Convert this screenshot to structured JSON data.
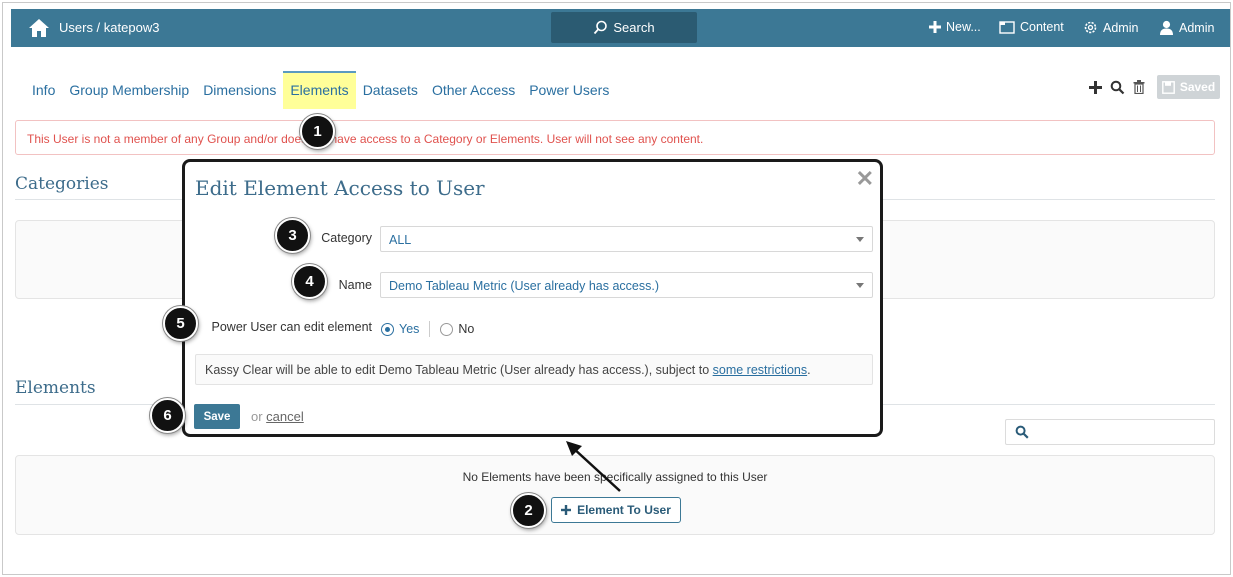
{
  "topbar": {
    "breadcrumb": "Users / katepow3",
    "search_label": "Search",
    "new_label": "New...",
    "content_label": "Content",
    "admin_label": "Admin",
    "user_label": "Admin"
  },
  "tabs": [
    "Info",
    "Group Membership",
    "Dimensions",
    "Elements",
    "Datasets",
    "Other Access",
    "Power Users"
  ],
  "active_tab": "Elements",
  "toolbar": {
    "saved_label": "Saved"
  },
  "alert": {
    "text": "This User is not a member of any Group and/or does not have access to a Category or Elements. User will not see any content."
  },
  "sections": {
    "categories_title": "Categories",
    "elements_title": "Elements"
  },
  "elements_panel": {
    "empty_message": "No Elements have been specifically assigned to this User",
    "add_button": "Element To User"
  },
  "modal": {
    "title": "Edit Element Access to User",
    "category_label": "Category",
    "category_value": "ALL",
    "name_label": "Name",
    "name_value": "Demo  Tableau Metric (User already has access.)",
    "power_user_label": "Power User can edit element",
    "radio_yes": "Yes",
    "radio_no": "No",
    "selected": "Yes",
    "info_text": "Kassy Clear will be able to edit Demo Tableau Metric (User already has access.), subject to ",
    "info_link": "some restrictions",
    "info_end": ".",
    "save_label": "Save",
    "or_text": "or ",
    "cancel_label": "cancel"
  },
  "callouts": [
    "1",
    "2",
    "3",
    "4",
    "5",
    "6"
  ],
  "colors": {
    "topbar": "#3c7895",
    "accent": "#2a6fa0",
    "alert": "#e0524e",
    "active_tab": "#ffff99"
  }
}
